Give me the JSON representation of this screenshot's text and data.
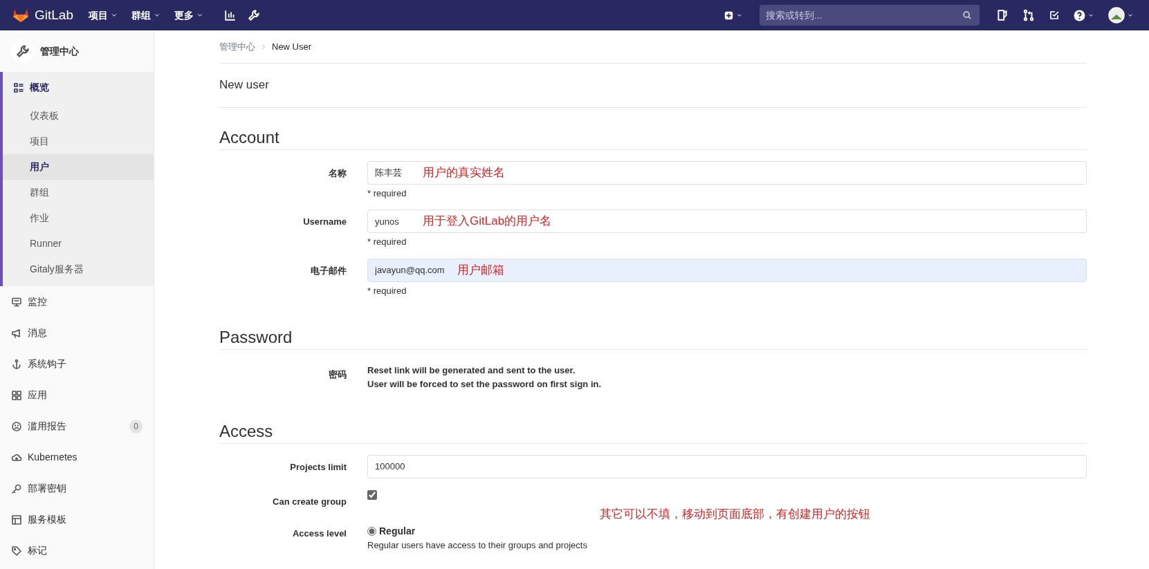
{
  "navbar": {
    "brand": "GitLab",
    "menus": [
      {
        "label": "项目"
      },
      {
        "label": "群组"
      },
      {
        "label": "更多"
      }
    ],
    "search": {
      "placeholder": "搜索或转到..."
    }
  },
  "sidebar": {
    "title": "管理中心",
    "items": [
      {
        "label": "概览",
        "selected": true,
        "children": [
          {
            "label": "仪表板",
            "selected": false
          },
          {
            "label": "项目",
            "selected": false
          },
          {
            "label": "用户",
            "selected": true
          },
          {
            "label": "群组",
            "selected": false
          },
          {
            "label": "作业",
            "selected": false
          },
          {
            "label": "Runner",
            "selected": false
          },
          {
            "label": "Gitaly服务器",
            "selected": false
          }
        ]
      },
      {
        "label": "监控",
        "selected": false
      },
      {
        "label": "消息",
        "selected": false
      },
      {
        "label": "系统钩子",
        "selected": false
      },
      {
        "label": "应用",
        "selected": false
      },
      {
        "label": "滥用报告",
        "selected": false,
        "badge": "0"
      },
      {
        "label": "Kubernetes",
        "selected": false
      },
      {
        "label": "部署密钥",
        "selected": false
      },
      {
        "label": "服务模板",
        "selected": false
      },
      {
        "label": "标记",
        "selected": false
      }
    ]
  },
  "breadcrumb": [
    "管理中心",
    "New User"
  ],
  "page_title": "New user",
  "sections": [
    {
      "title": "Account",
      "rows": [
        {
          "kind": "input",
          "label": "名称",
          "value": "陈丰芸",
          "hint": "* required",
          "annotation": "用户的真实姓名",
          "autofilled": false
        },
        {
          "kind": "input",
          "label": "Username",
          "value": "yunos",
          "hint": "* required",
          "annotation": "用于登入GitLab的用户名",
          "autofilled": false
        },
        {
          "kind": "input",
          "label": "电子邮件",
          "value": "javayun@qq.com",
          "hint": "* required",
          "annotation": "用户邮箱",
          "autofilled": true
        }
      ]
    },
    {
      "title": "Password",
      "rows": [
        {
          "kind": "text",
          "label": "密码",
          "lines": [
            "Reset link will be generated and sent to the user.",
            "User will be forced to set the password on first sign in."
          ]
        }
      ]
    },
    {
      "title": "Access",
      "rows": [
        {
          "kind": "input",
          "label": "Projects limit",
          "value": "100000",
          "autofilled": false
        },
        {
          "kind": "checkbox",
          "label": "Can create group",
          "checked": true,
          "note": "其它可以不填，移动到页面底部，有创建用户的按钮"
        },
        {
          "kind": "radio",
          "label": "Access level",
          "options": [
            {
              "label": "Regular",
              "selected": true,
              "description": "Regular users have access to their groups and projects"
            }
          ]
        }
      ]
    }
  ]
}
